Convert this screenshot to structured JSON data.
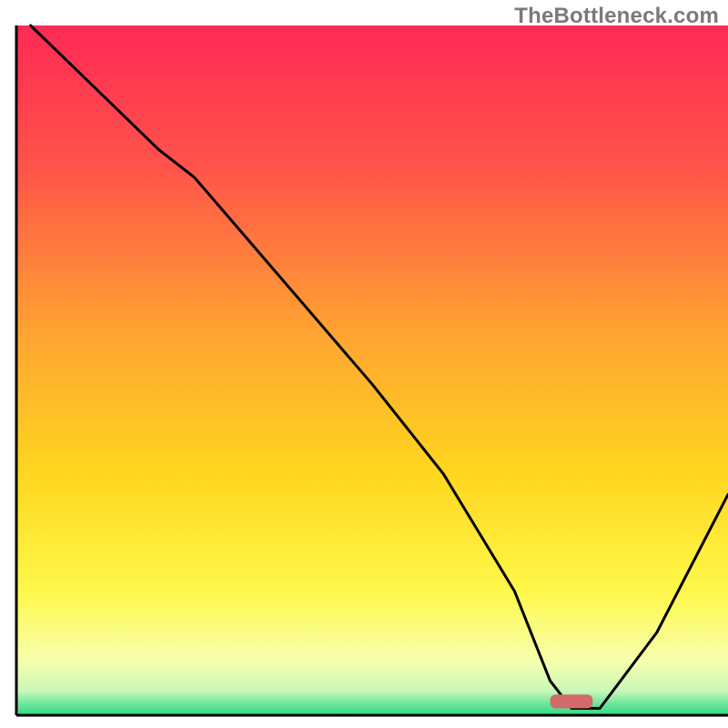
{
  "watermark": "TheBottleneck.com",
  "chart_data": {
    "type": "line",
    "title": "",
    "xlabel": "",
    "ylabel": "",
    "xlim": [
      0,
      100
    ],
    "ylim": [
      0,
      100
    ],
    "x": [
      2,
      10,
      20,
      25,
      30,
      40,
      50,
      60,
      70,
      75,
      78,
      82,
      90,
      100
    ],
    "values": [
      100,
      92,
      82,
      78,
      72,
      60,
      48,
      35,
      18,
      5,
      1,
      1,
      12,
      32
    ],
    "marker": {
      "x": 78,
      "y": 2,
      "width": 6,
      "height": 2,
      "color": "#d46a6a"
    },
    "gradient_stops": [
      {
        "offset": 0.0,
        "color": "#ff2a55"
      },
      {
        "offset": 0.2,
        "color": "#ff524a"
      },
      {
        "offset": 0.45,
        "color": "#ffa531"
      },
      {
        "offset": 0.65,
        "color": "#ffd61f"
      },
      {
        "offset": 0.82,
        "color": "#fff84a"
      },
      {
        "offset": 0.92,
        "color": "#f7ffab"
      },
      {
        "offset": 0.965,
        "color": "#c9f7b8"
      },
      {
        "offset": 0.985,
        "color": "#66e59a"
      },
      {
        "offset": 1.0,
        "color": "#2fd985"
      }
    ],
    "axis_color": "#000000",
    "line_color": "#000000",
    "line_width": 3
  }
}
